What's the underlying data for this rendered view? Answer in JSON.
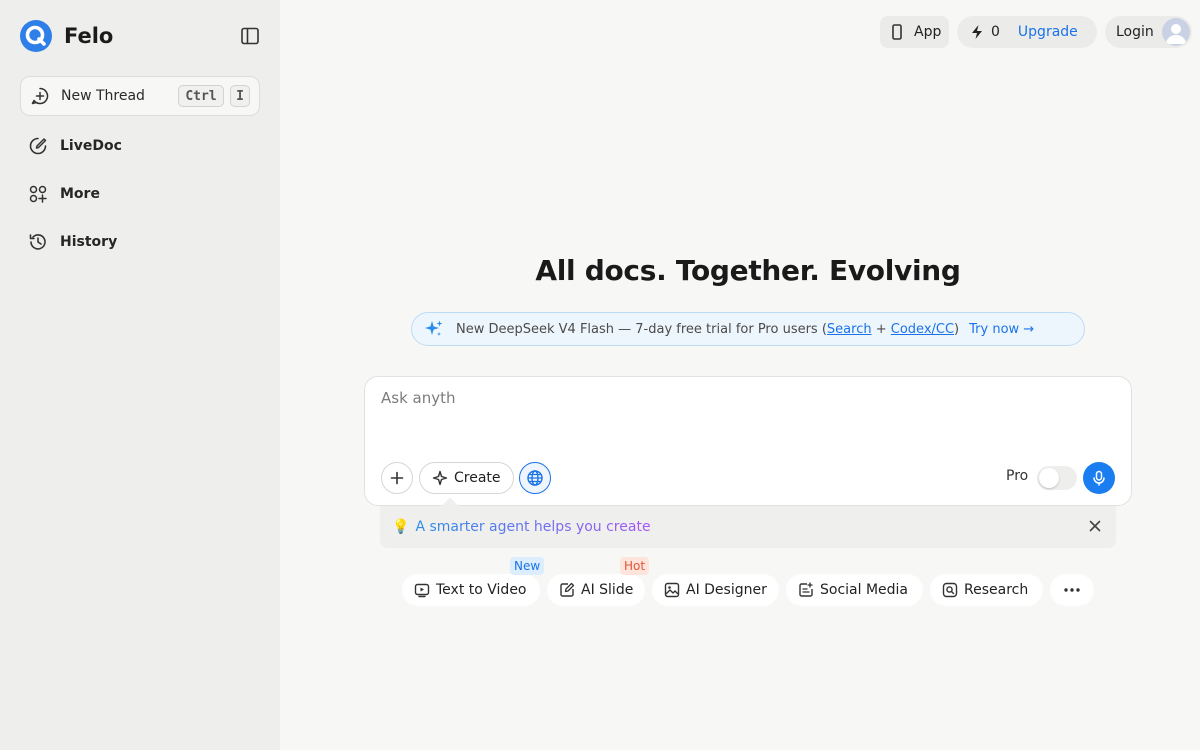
{
  "app": {
    "name": "Felo"
  },
  "sidebar": {
    "new_thread": {
      "label": "New Thread",
      "shortcut_mod": "Ctrl",
      "shortcut_key": "I"
    },
    "items": [
      {
        "label": "LiveDoc",
        "icon": "edit-icon"
      },
      {
        "label": "More",
        "icon": "apps-icon"
      },
      {
        "label": "History",
        "icon": "history-icon"
      }
    ]
  },
  "header": {
    "app_label": "App",
    "credits": "0",
    "upgrade_label": "Upgrade",
    "login_label": "Login"
  },
  "main": {
    "title": "All docs. Together. Evolving",
    "promo": {
      "prefix": "New DeepSeek V4 Flash — 7-day free trial for Pro users (",
      "link1": "Search",
      "plus": " + ",
      "link2": "Codex/CC",
      "suffix": ")",
      "cta": "Try now →"
    },
    "composer": {
      "value": "",
      "placeholder": "Ask anyth",
      "create_label": "Create",
      "pro_label": "Pro",
      "pro_enabled": false
    },
    "hint": {
      "text": "A smarter agent helps you create"
    },
    "chips": [
      {
        "label": "Text to Video",
        "badge": "New"
      },
      {
        "label": "AI Slide",
        "badge": "Hot"
      },
      {
        "label": "AI Designer"
      },
      {
        "label": "Social Media"
      },
      {
        "label": "Research"
      }
    ]
  },
  "colors": {
    "accent": "#1a73e8",
    "mic": "#1a7df0",
    "logo": "#2f7fe8",
    "sidebar_bg": "#eeeeec",
    "page_bg": "#f7f7f5"
  }
}
